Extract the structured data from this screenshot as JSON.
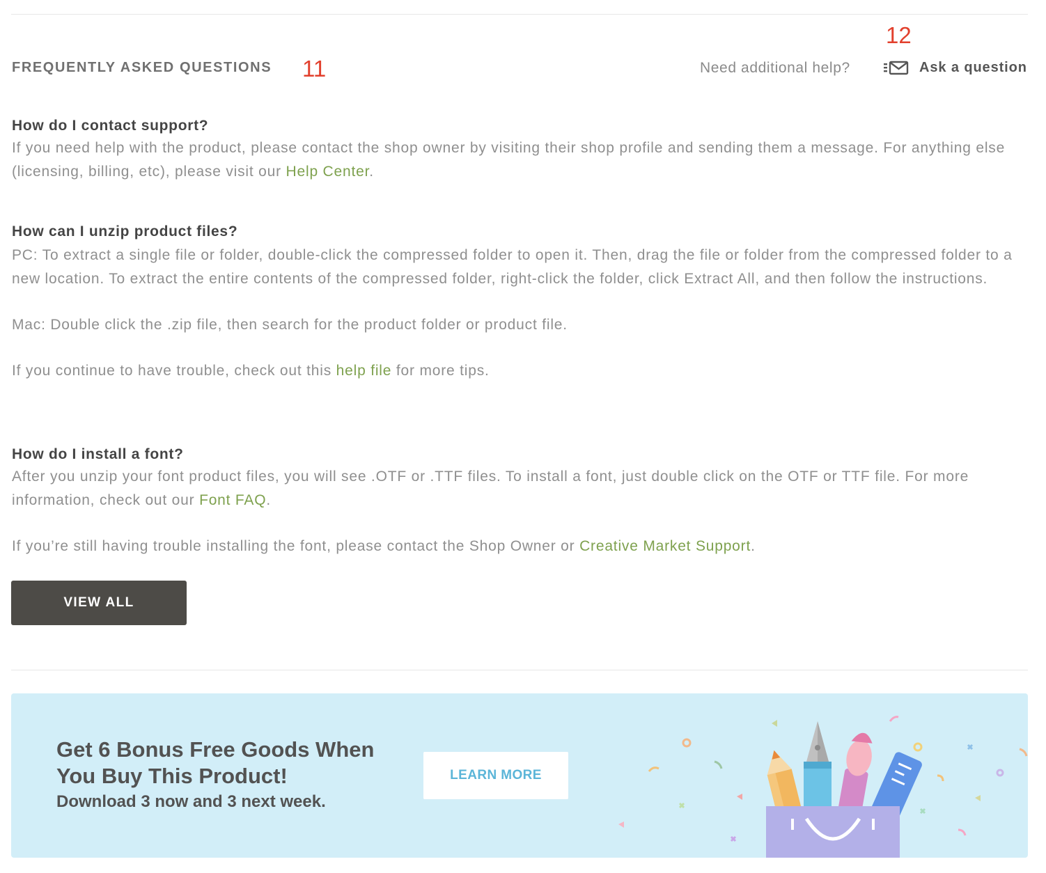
{
  "faq": {
    "heading": "FREQUENTLY ASKED QUESTIONS",
    "marker_heading": "11",
    "marker_ask": "12",
    "need_help": "Need additional help?",
    "ask_label": "Ask a question",
    "items": [
      {
        "question": "How do I contact support?",
        "answer_a": "If you need help with the product, please contact the shop owner by visiting their shop profile and sending them a message. For anything else (licensing, billing, etc), please visit our ",
        "answer_link": "Help Center",
        "answer_b": "."
      },
      {
        "question": "How can I unzip product files?",
        "para1": "PC: To extract a single file or folder, double-click the compressed folder to open it. Then, drag the file or folder from the compressed folder to a new location. To extract the entire contents of the compressed folder, right-click the folder, click Extract All, and then follow the instructions.",
        "para2": "Mac: Double click the .zip file, then search for the product folder or product file.",
        "para3_a": "If you continue to have trouble, check out this ",
        "para3_link": "help file",
        "para3_b": " for more tips."
      },
      {
        "question": "How do I install a font?",
        "para1_a": "After you unzip your font product files, you will see .OTF or .TTF files. To install a font, just double click on the OTF or TTF file. For more information, check out our ",
        "para1_link": "Font FAQ",
        "para1_b": ".",
        "para2_a": "If you’re still having trouble installing the font, please contact the Shop Owner or ",
        "para2_link": "Creative Market Support",
        "para2_b": "."
      }
    ],
    "view_all": "VIEW ALL"
  },
  "promo": {
    "title": "Get 6 Bonus Free Goods When You Buy This Product!",
    "subtitle": "Download 3 now and 3 next week.",
    "button": "LEARN MORE",
    "illustration": "shopping-bag-with-art-tools-icon"
  },
  "colors": {
    "link": "#7ea14e",
    "marker": "#e2402d",
    "promo_bg": "#d2eef8",
    "promo_button_text": "#5bb5d8",
    "view_all_bg": "#4d4b47"
  }
}
